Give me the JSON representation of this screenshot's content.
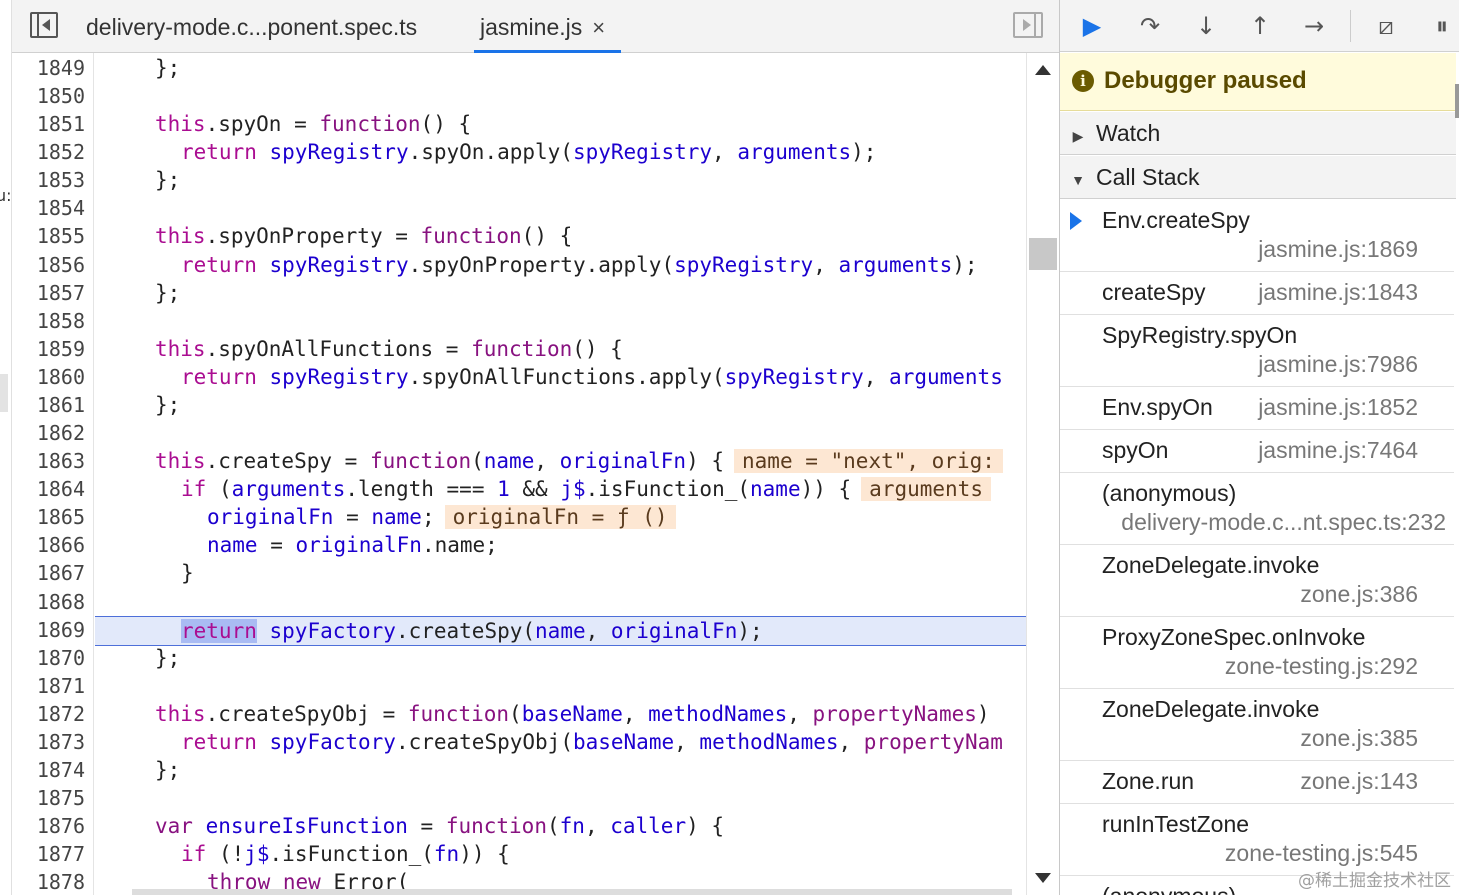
{
  "editor": {
    "tabs": [
      {
        "label": "delivery-mode.c...ponent.spec.ts",
        "active": false
      },
      {
        "label": "jasmine.js",
        "active": true,
        "close": "×"
      }
    ],
    "lines": [
      {
        "n": "1849",
        "indent": 1,
        "parts": [
          [
            "p",
            "};"
          ]
        ]
      },
      {
        "n": "1850",
        "indent": 0,
        "parts": []
      },
      {
        "n": "1851",
        "indent": 1,
        "parts": [
          [
            "kw",
            "this"
          ],
          [
            "p",
            "."
          ],
          [
            "p",
            "spyOn"
          ],
          [
            "p",
            " = "
          ],
          [
            "kw2",
            "function"
          ],
          [
            "p",
            "() {"
          ]
        ]
      },
      {
        "n": "1852",
        "indent": 2,
        "parts": [
          [
            "kw",
            "return"
          ],
          [
            "p",
            " "
          ],
          [
            "id",
            "spyRegistry"
          ],
          [
            "p",
            ".spyOn.apply("
          ],
          [
            "id",
            "spyRegistry"
          ],
          [
            "p",
            ", "
          ],
          [
            "id",
            "arguments"
          ],
          [
            "p",
            ");"
          ]
        ]
      },
      {
        "n": "1853",
        "indent": 1,
        "parts": [
          [
            "p",
            "};"
          ]
        ]
      },
      {
        "n": "1854",
        "indent": 0,
        "parts": []
      },
      {
        "n": "1855",
        "indent": 1,
        "parts": [
          [
            "kw",
            "this"
          ],
          [
            "p",
            ".spyOnProperty = "
          ],
          [
            "kw2",
            "function"
          ],
          [
            "p",
            "() {"
          ]
        ]
      },
      {
        "n": "1856",
        "indent": 2,
        "parts": [
          [
            "kw",
            "return"
          ],
          [
            "p",
            " "
          ],
          [
            "id",
            "spyRegistry"
          ],
          [
            "p",
            ".spyOnProperty.apply("
          ],
          [
            "id",
            "spyRegistry"
          ],
          [
            "p",
            ", "
          ],
          [
            "id",
            "arguments"
          ],
          [
            "p",
            ");"
          ]
        ]
      },
      {
        "n": "1857",
        "indent": 1,
        "parts": [
          [
            "p",
            "};"
          ]
        ]
      },
      {
        "n": "1858",
        "indent": 0,
        "parts": []
      },
      {
        "n": "1859",
        "indent": 1,
        "parts": [
          [
            "kw",
            "this"
          ],
          [
            "p",
            ".spyOnAllFunctions = "
          ],
          [
            "kw2",
            "function"
          ],
          [
            "p",
            "() {"
          ]
        ]
      },
      {
        "n": "1860",
        "indent": 2,
        "parts": [
          [
            "kw",
            "return"
          ],
          [
            "p",
            " "
          ],
          [
            "id",
            "spyRegistry"
          ],
          [
            "p",
            ".spyOnAllFunctions.apply("
          ],
          [
            "id",
            "spyRegistry"
          ],
          [
            "p",
            ", "
          ],
          [
            "id",
            "arguments"
          ]
        ]
      },
      {
        "n": "1861",
        "indent": 1,
        "parts": [
          [
            "p",
            "};"
          ]
        ]
      },
      {
        "n": "1862",
        "indent": 0,
        "parts": []
      },
      {
        "n": "1863",
        "indent": 1,
        "parts": [
          [
            "kw",
            "this"
          ],
          [
            "p",
            ".createSpy = "
          ],
          [
            "kw2",
            "function"
          ],
          [
            "p",
            "("
          ],
          [
            "id",
            "name"
          ],
          [
            "p",
            ", "
          ],
          [
            "id",
            "originalFn"
          ],
          [
            "p",
            ") {"
          ],
          [
            "iv",
            "name = \"next\", orig:"
          ]
        ]
      },
      {
        "n": "1864",
        "indent": 2,
        "parts": [
          [
            "kw",
            "if"
          ],
          [
            "p",
            " ("
          ],
          [
            "id",
            "arguments"
          ],
          [
            "p",
            ".length === "
          ],
          [
            "num",
            "1"
          ],
          [
            "p",
            " && "
          ],
          [
            "id",
            "j$"
          ],
          [
            "p",
            ".isFunction_("
          ],
          [
            "id",
            "name"
          ],
          [
            "p",
            ")) {"
          ],
          [
            "iv",
            "arguments"
          ]
        ]
      },
      {
        "n": "1865",
        "indent": 3,
        "parts": [
          [
            "id",
            "originalFn"
          ],
          [
            "p",
            " = "
          ],
          [
            "id",
            "name"
          ],
          [
            "p",
            ";"
          ],
          [
            "iv",
            "originalFn = ƒ ()"
          ]
        ]
      },
      {
        "n": "1866",
        "indent": 3,
        "parts": [
          [
            "id",
            "name"
          ],
          [
            "p",
            " = "
          ],
          [
            "id",
            "originalFn"
          ],
          [
            "p",
            ".name;"
          ]
        ]
      },
      {
        "n": "1867",
        "indent": 2,
        "parts": [
          [
            "p",
            "}"
          ]
        ]
      },
      {
        "n": "1868",
        "indent": 0,
        "parts": []
      },
      {
        "n": "1869",
        "indent": 2,
        "paused": true,
        "parts": [
          [
            "ret",
            "return"
          ],
          [
            "p",
            " "
          ],
          [
            "id",
            "spyFactory"
          ],
          [
            "p",
            ".createSpy("
          ],
          [
            "id",
            "name"
          ],
          [
            "p",
            ", "
          ],
          [
            "id",
            "originalFn"
          ],
          [
            "p",
            ");"
          ]
        ]
      },
      {
        "n": "1870",
        "indent": 1,
        "parts": [
          [
            "p",
            "};"
          ]
        ]
      },
      {
        "n": "1871",
        "indent": 0,
        "parts": []
      },
      {
        "n": "1872",
        "indent": 1,
        "parts": [
          [
            "kw",
            "this"
          ],
          [
            "p",
            ".createSpyObj = "
          ],
          [
            "kw2",
            "function"
          ],
          [
            "p",
            "("
          ],
          [
            "id",
            "baseName"
          ],
          [
            "p",
            ", "
          ],
          [
            "id",
            "methodNames"
          ],
          [
            "p",
            ", "
          ],
          [
            "kw2",
            "propertyNames"
          ],
          [
            "p",
            ")"
          ]
        ]
      },
      {
        "n": "1873",
        "indent": 2,
        "parts": [
          [
            "kw",
            "return"
          ],
          [
            "p",
            " "
          ],
          [
            "id",
            "spyFactory"
          ],
          [
            "p",
            ".createSpyObj("
          ],
          [
            "id",
            "baseName"
          ],
          [
            "p",
            ", "
          ],
          [
            "id",
            "methodNames"
          ],
          [
            "p",
            ", "
          ],
          [
            "kw2",
            "propertyNam"
          ]
        ]
      },
      {
        "n": "1874",
        "indent": 1,
        "parts": [
          [
            "p",
            "};"
          ]
        ]
      },
      {
        "n": "1875",
        "indent": 0,
        "parts": []
      },
      {
        "n": "1876",
        "indent": 1,
        "parts": [
          [
            "kw2",
            "var"
          ],
          [
            "p",
            " "
          ],
          [
            "id",
            "ensureIsFunction"
          ],
          [
            "p",
            " = "
          ],
          [
            "kw2",
            "function"
          ],
          [
            "p",
            "("
          ],
          [
            "id",
            "fn"
          ],
          [
            "p",
            ", "
          ],
          [
            "id",
            "caller"
          ],
          [
            "p",
            ") {"
          ]
        ]
      },
      {
        "n": "1877",
        "indent": 2,
        "parts": [
          [
            "kw",
            "if"
          ],
          [
            "p",
            " (!"
          ],
          [
            "id",
            "j$"
          ],
          [
            "p",
            ".isFunction_("
          ],
          [
            "id",
            "fn"
          ],
          [
            "p",
            ")) {"
          ]
        ]
      },
      {
        "n": "1878",
        "indent": 3,
        "parts": [
          [
            "kw2",
            "throw"
          ],
          [
            "p",
            " "
          ],
          [
            "kw2",
            "new"
          ],
          [
            "p",
            " Error("
          ]
        ]
      }
    ]
  },
  "debugger": {
    "toolbar": {
      "resume": "▶",
      "step_over": "↷",
      "step_into": "↓",
      "step_out": "↑",
      "step": "→",
      "deactivate": "⧄",
      "pause_exceptions": "⏸"
    },
    "paused_banner": {
      "info": "i",
      "text": "Debugger paused"
    },
    "watch": {
      "label": "Watch",
      "arrow": "▶"
    },
    "call_stack": {
      "label": "Call Stack",
      "arrow": "▼"
    },
    "frames": [
      {
        "fn": "Env.createSpy",
        "loc": "jasmine.js:1869",
        "current": true,
        "two_line": true
      },
      {
        "fn": "createSpy",
        "loc": "jasmine.js:1843",
        "two_line": false
      },
      {
        "fn": "SpyRegistry.spyOn",
        "loc": "jasmine.js:7986",
        "two_line": true
      },
      {
        "fn": "Env.spyOn",
        "loc": "jasmine.js:1852",
        "two_line": false
      },
      {
        "fn": "spyOn",
        "loc": "jasmine.js:7464",
        "two_line": false
      },
      {
        "fn": "(anonymous)",
        "loc": "delivery-mode.c...nt.spec.ts:232",
        "two_line": true
      },
      {
        "fn": "ZoneDelegate.invoke",
        "loc": "zone.js:386",
        "two_line": true
      },
      {
        "fn": "ProxyZoneSpec.onInvoke",
        "loc": "zone-testing.js:292",
        "two_line": true
      },
      {
        "fn": "ZoneDelegate.invoke",
        "loc": "zone.js:385",
        "two_line": true
      },
      {
        "fn": "Zone.run",
        "loc": "zone.js:143",
        "two_line": false
      },
      {
        "fn": "runInTestZone",
        "loc": "zone-testing.js:545",
        "two_line": true
      },
      {
        "fn": "(anonymous)",
        "loc": "",
        "two_line": false
      }
    ]
  },
  "watermark": "@稀土掘金技术社区",
  "left_edge_text": "u:"
}
